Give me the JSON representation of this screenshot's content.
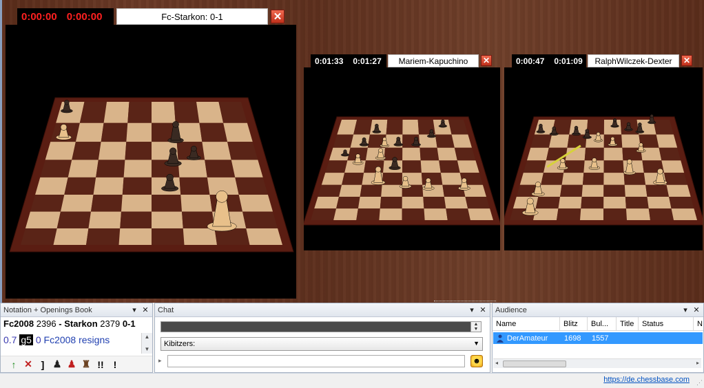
{
  "boards": [
    {
      "clock_white": "0:00:00",
      "clock_black": "0:00:00",
      "game": "Fc-Starkon: 0-1"
    },
    {
      "clock_white": "0:01:33",
      "clock_black": "0:01:27",
      "game": "Mariem-Kapuchino"
    },
    {
      "clock_white": "0:00:47",
      "clock_black": "0:01:09",
      "game": "RalphWilczek-Dexter"
    }
  ],
  "notation": {
    "title": "Notation + Openings Book",
    "white_player": "Fc2008",
    "white_elo": "2396",
    "separator": "-",
    "black_player": "Starkon",
    "black_elo": "2379",
    "result": "0-1",
    "eval": "0.7",
    "last_move": "g5",
    "move_eval": "0",
    "resign_text": "Fc2008 resigns",
    "toolbar": [
      {
        "icon": "green-up-arrow-icon",
        "glyph": "↑",
        "color": "#1a8a1a"
      },
      {
        "icon": "delete-move-icon",
        "glyph": "✕",
        "color": "#c02020"
      },
      {
        "icon": "bracket-icon",
        "glyph": "]",
        "color": "#000000"
      },
      {
        "icon": "black-pawn-icon",
        "glyph": "♟",
        "color": "#222222"
      },
      {
        "icon": "red-pawn-icon",
        "glyph": "♟",
        "color": "#c02020"
      },
      {
        "icon": "pieces-icon",
        "glyph": "♜",
        "color": "#6a4020"
      },
      {
        "icon": "double-exclam-icon",
        "glyph": "!!",
        "color": "#000000"
      },
      {
        "icon": "exclam-icon",
        "glyph": "!",
        "color": "#000000"
      }
    ]
  },
  "chat": {
    "title": "Chat",
    "channel": "Kibitzers:"
  },
  "audience": {
    "title": "Audience",
    "columns": [
      "Name",
      "Blitz",
      "Bul...",
      "Title",
      "Status",
      "N"
    ],
    "rows": [
      {
        "name": "DerAmateur",
        "blitz": "1698",
        "bullet": "1557",
        "title": "",
        "status": ""
      }
    ]
  },
  "status": {
    "link": "https://de.chessbase.com"
  }
}
